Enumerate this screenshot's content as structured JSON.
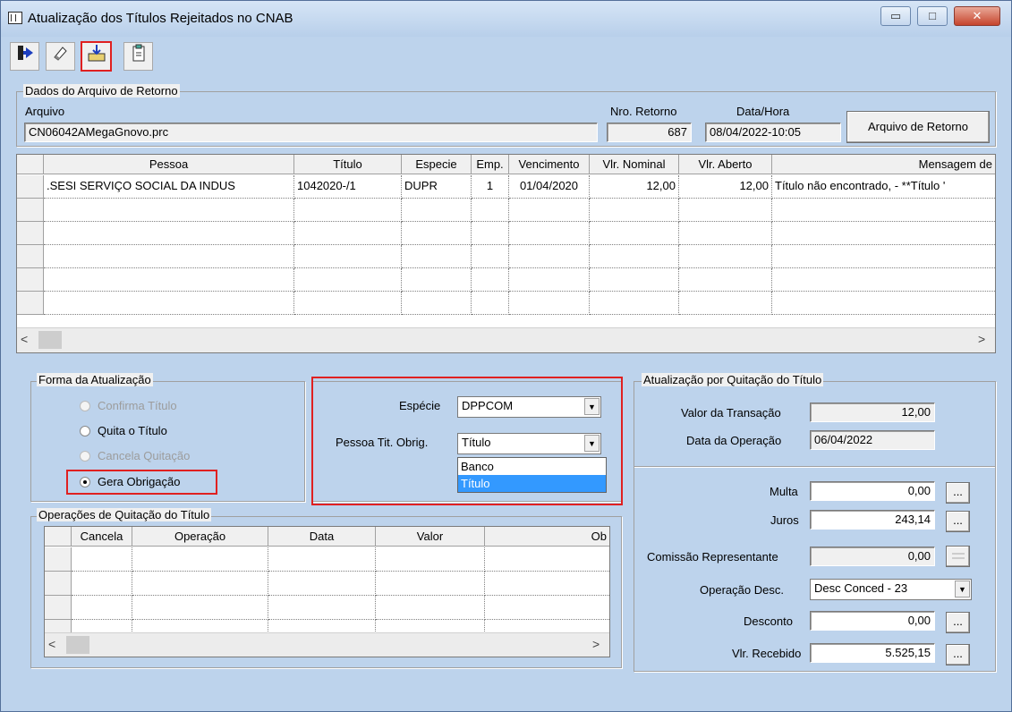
{
  "window": {
    "title": "Atualização dos Títulos Rejeitados no CNAB",
    "min": "▭",
    "max": "□",
    "close": "✕"
  },
  "toolbar": {
    "icons": [
      "exit-icon",
      "eraser-icon",
      "import-icon",
      "clipboard-icon"
    ]
  },
  "arquivo": {
    "legend": "Dados do Arquivo de Retorno",
    "arquivo_label": "Arquivo",
    "arquivo_value": "CN06042AMegaGnovo.prc",
    "nro_label": "Nro. Retorno",
    "nro_value": "687",
    "datahora_label": "Data/Hora",
    "datahora_value": "08/04/2022-10:05",
    "button": "Arquivo de Retorno"
  },
  "main_grid": {
    "columns": [
      "Pessoa",
      "Título",
      "Especie",
      "Emp.",
      "Vencimento",
      "Vlr. Nominal",
      "Vlr. Aberto",
      "Mensagem de"
    ],
    "rows": [
      [
        ".SESI SERVIÇO SOCIAL DA INDUS",
        "1042020-/1",
        "DUPR",
        "1",
        "01/04/2020",
        "12,00",
        "12,00",
        "Título não encontrado,  - **Título '"
      ]
    ]
  },
  "forma": {
    "legend": "Forma da Atualização",
    "options": [
      "Confirma Título",
      "Quita o Título",
      "Cancela Quitação",
      "Gera Obrigação"
    ],
    "selected": "Gera Obrigação"
  },
  "middle": {
    "especie_label": "Espécie",
    "especie_value": "DPPCOM",
    "pessoa_label": "Pessoa Tit. Obrig.",
    "pessoa_value": "Título",
    "dropdown_options": [
      "Banco",
      "Título"
    ],
    "dropdown_selected": "Título"
  },
  "operacoes": {
    "legend": "Operações de Quitação do Título",
    "columns": [
      "Cancela",
      "Operação",
      "Data",
      "Valor",
      "Ob"
    ]
  },
  "quitacao": {
    "legend": "Atualização por Quitação do Título",
    "valor_label": "Valor da Transação",
    "valor_value": "12,00",
    "data_label": "Data da Operação",
    "data_value": "06/04/2022",
    "multa_label": "Multa",
    "multa_value": "0,00",
    "juros_label": "Juros",
    "juros_value": "243,14",
    "comissao_label": "Comissão Representante",
    "comissao_value": "0,00",
    "opdesc_label": "Operação Desc.",
    "opdesc_value": "Desc Conced - 23",
    "desconto_label": "Desconto",
    "desconto_value": "0,00",
    "recebido_label": "Vlr. Recebido",
    "recebido_value": "5.525,15",
    "ellipsis": "..."
  }
}
